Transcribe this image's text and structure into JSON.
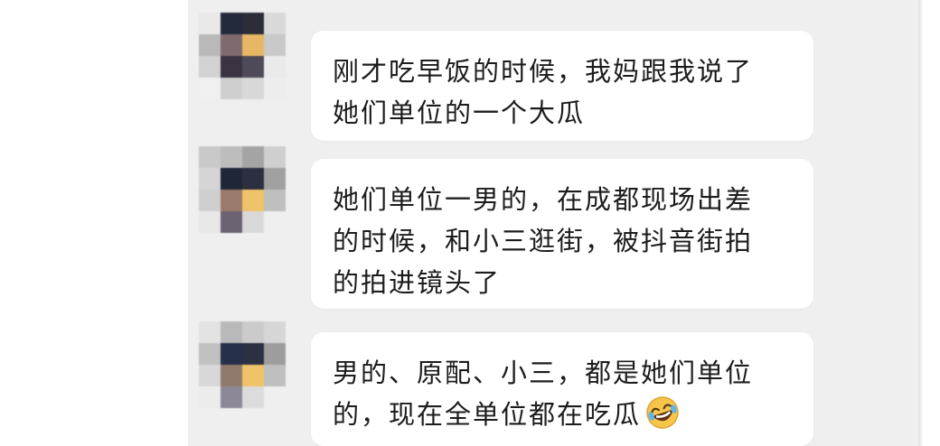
{
  "messages": [
    {
      "lines": [
        "刚才吃早饭的时候，我妈跟我说了",
        "她们单位的一个大瓜"
      ],
      "avatar_colors": [
        "#e9e9e9",
        "#232a3c",
        "#2a2d38",
        "#d9d9d9",
        "#b9b9b9",
        "#7e6a6f",
        "#e7b765",
        "#c9c9c9",
        "#d2d2d2",
        "#3b3440",
        "#4e4a58",
        "#eaeaea",
        "#f0f0f0",
        "#cfcfcf",
        "#d8d8d8",
        "#ededed"
      ]
    },
    {
      "lines": [
        "她们单位一男的，在成都现场出差",
        "的时候，和小三逛街，被抖音街拍",
        "的拍进镜头了"
      ],
      "avatar_colors": [
        "#c9c9c9",
        "#bdbdbd",
        "#a4a4a4",
        "#cfcfcf",
        "#d5d5d5",
        "#1f2638",
        "#2b2f3f",
        "#a0a0a0",
        "#cfcfcf",
        "#9a7b6b",
        "#efc36a",
        "#bfbfbf",
        "#e8e8e8",
        "#6b6272",
        "#d9d9d9",
        "#efefef"
      ]
    },
    {
      "lines": [
        "男的、原配、小三，都是她们单位",
        "的，现在全单位都在吃瓜"
      ],
      "emoji": "rolling-laughing-emoji",
      "avatar_colors": [
        "#e3e3e3",
        "#b9b9b9",
        "#cbcbcb",
        "#d6d6d6",
        "#c1c1c1",
        "#26304a",
        "#2b3042",
        "#9d9d9d",
        "#d8d8d8",
        "#8f7a6b",
        "#efc469",
        "#bfbfbf",
        "#ececec",
        "#8d8897",
        "#dcdcdc",
        "#efefef"
      ]
    }
  ],
  "colors": {
    "panel_background": "#efefef",
    "bubble_background": "#ffffff",
    "text": "#1c1c1c"
  }
}
